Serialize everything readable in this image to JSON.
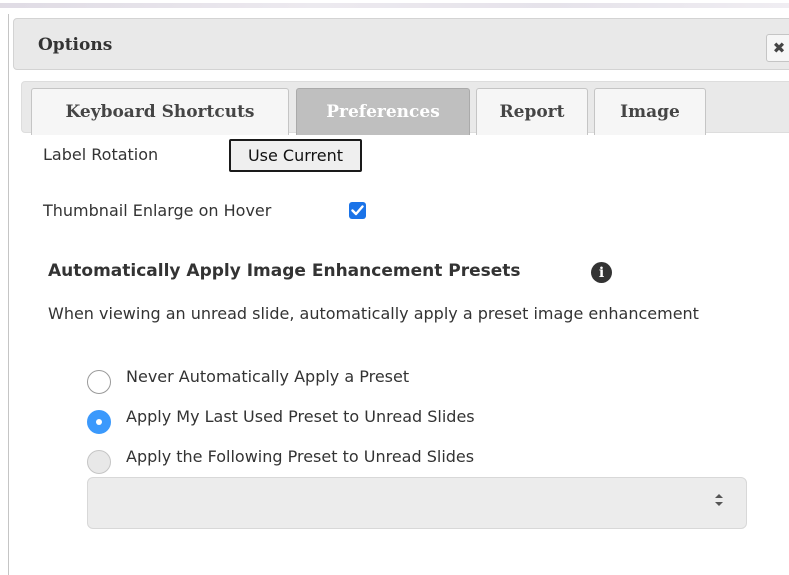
{
  "dialog": {
    "title": "Options",
    "close_glyph": "✖"
  },
  "tabs": [
    {
      "label": "Keyboard Shortcuts",
      "active": false
    },
    {
      "label": "Preferences",
      "active": true
    },
    {
      "label": "Report",
      "active": false
    },
    {
      "label": "Image",
      "active": false
    }
  ],
  "preferences": {
    "label_rotation": {
      "label": "Label Rotation",
      "button_label": "Use Current"
    },
    "thumbnail": {
      "label": "Thumbnail Enlarge on Hover",
      "checked": true
    },
    "presets": {
      "heading": "Automatically Apply Image Enhancement Presets",
      "info_icon": "info-circle-icon",
      "description": "When viewing an unread slide, automatically apply a preset image enhancement",
      "options": [
        {
          "label": "Never Automatically Apply a Preset",
          "selected": false
        },
        {
          "label": "Apply My Last Used Preset to Unread Slides",
          "selected": true
        },
        {
          "label": "Apply the Following Preset to Unread Slides",
          "selected": false
        }
      ],
      "select_value": ""
    }
  },
  "colors": {
    "accent": "#3b99fc",
    "checkbox": "#1a73e8",
    "active_tab": "#bfbfbf"
  }
}
